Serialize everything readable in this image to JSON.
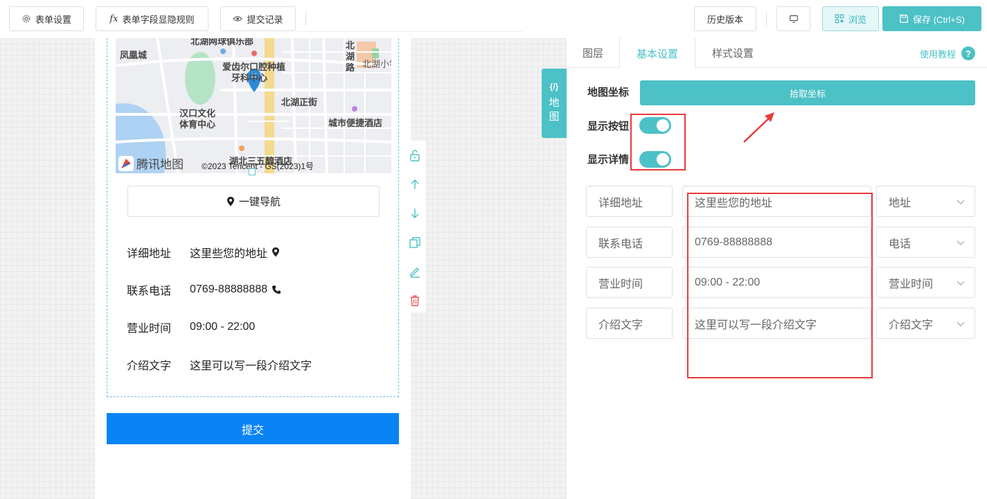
{
  "toolbar": {
    "form_settings": "表单设置",
    "field_rules": "表单字段显隐规则",
    "submit_records": "提交记录",
    "history": "历史版本",
    "preview": "浏览",
    "save": "保存 (Ctrl+S)"
  },
  "map": {
    "labels": {
      "club": "北湖网球俱乐部",
      "fenghuang": "凤凰城",
      "clinic_1": "爱齿尔口腔种植",
      "clinic_2": "牙科中心",
      "road_1": "北",
      "road_2": "湖",
      "road_3": "路",
      "school": "北湖小学",
      "street": "北湖正街",
      "center_1": "汉口文化",
      "center_2": "体育中心",
      "hotel": "城市便捷酒店",
      "hotel2": "湖北三五醇酒店"
    },
    "logo_text": "腾讯地图",
    "credit": "©2023 Tencent - GS(2023)1号"
  },
  "preview": {
    "navigate_label": "一键导航",
    "rows": [
      {
        "label": "详细地址",
        "value": "这里些您的地址",
        "icon": "location-icon"
      },
      {
        "label": "联系电话",
        "value": "0769-88888888",
        "icon": "phone-icon"
      },
      {
        "label": "营业时间",
        "value": "09:00 - 22:00",
        "icon": ""
      },
      {
        "label": "介绍文字",
        "value": "这里可以写一段介绍文字",
        "icon": ""
      }
    ],
    "submit_label": "提交"
  },
  "component_tag": {
    "code": "{/}",
    "char1": "地",
    "char2": "图"
  },
  "panel": {
    "tabs": [
      "图层",
      "基本设置",
      "样式设置"
    ],
    "active_tab": "基本设置",
    "help_label": "使用教程",
    "coord_label": "地图坐标",
    "pick_coord": "拾取坐标",
    "show_button_label": "显示按钮",
    "show_detail_label": "显示详情",
    "show_button_on": true,
    "show_detail_on": true,
    "rows": [
      {
        "key": "详细地址",
        "value": "这里些您的地址",
        "type": "地址"
      },
      {
        "key": "联系电话",
        "value": "0769-88888888",
        "type": "电话"
      },
      {
        "key": "营业时间",
        "value": "09:00 - 22:00",
        "type": "营业时间"
      },
      {
        "key": "介绍文字",
        "value": "这里可以写一段介绍文字",
        "type": "介绍文字"
      }
    ]
  },
  "colors": {
    "accent": "#4cc1c6",
    "submit": "#0a83f5",
    "highlight": "#e93a3a"
  }
}
